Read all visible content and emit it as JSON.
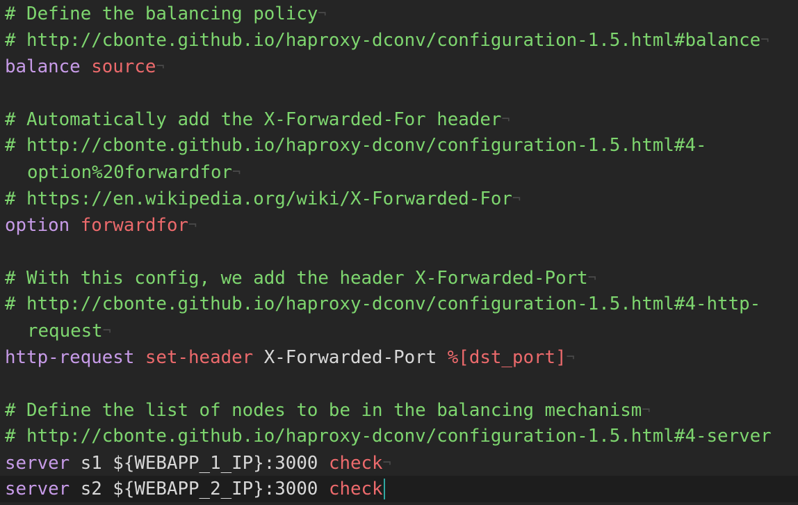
{
  "editor": {
    "lines": [
      {
        "type": "comment",
        "text": "# Define the balancing policy"
      },
      {
        "type": "comment",
        "text": "# http://cbonte.github.io/haproxy-dconv/configuration-1.5.html#balance"
      },
      {
        "type": "directive",
        "keyword": "balance",
        "value": "source"
      },
      {
        "type": "blank"
      },
      {
        "type": "comment",
        "text": "# Automatically add the X-Forwarded-For header"
      },
      {
        "type": "comment",
        "text": "# http://cbonte.github.io/haproxy-dconv/configuration-1.5.html#4-"
      },
      {
        "type": "comment-wrap",
        "text": "option%20forwardfor"
      },
      {
        "type": "comment",
        "text": "# https://en.wikipedia.org/wiki/X-Forwarded-For"
      },
      {
        "type": "directive",
        "keyword": "option",
        "value": "forwardfor"
      },
      {
        "type": "blank"
      },
      {
        "type": "comment",
        "text": "# With this config, we add the header X-Forwarded-Port"
      },
      {
        "type": "comment",
        "text": "# http://cbonte.github.io/haproxy-dconv/configuration-1.5.html#4-http-"
      },
      {
        "type": "comment-wrap",
        "text": "request"
      },
      {
        "type": "http-request",
        "keyword": "http-request",
        "action": "set-header",
        "header": "X-Forwarded-Port",
        "expr": "%[dst_port]"
      },
      {
        "type": "blank"
      },
      {
        "type": "comment",
        "text": "# Define the list of nodes to be in the balancing mechanism"
      },
      {
        "type": "comment",
        "text": "# http://cbonte.github.io/haproxy-dconv/configuration-1.5.html#4-server"
      },
      {
        "type": "server",
        "keyword": "server",
        "args": "s1 ${WEBAPP_1_IP}:3000",
        "value": "check"
      },
      {
        "type": "server",
        "keyword": "server",
        "args": "s2 ${WEBAPP_2_IP}:3000",
        "value": "check",
        "current": true
      }
    ],
    "eol_marker": "¬"
  },
  "colors": {
    "background": "#252525",
    "current_line": "#1d1d1d",
    "comment": "#7ed66f",
    "keyword": "#c79be8",
    "value": "#ec6a6c",
    "plain": "#d8d8d8",
    "eol_marker": "#4a4a4a",
    "cursor": "#2fa7a0"
  }
}
